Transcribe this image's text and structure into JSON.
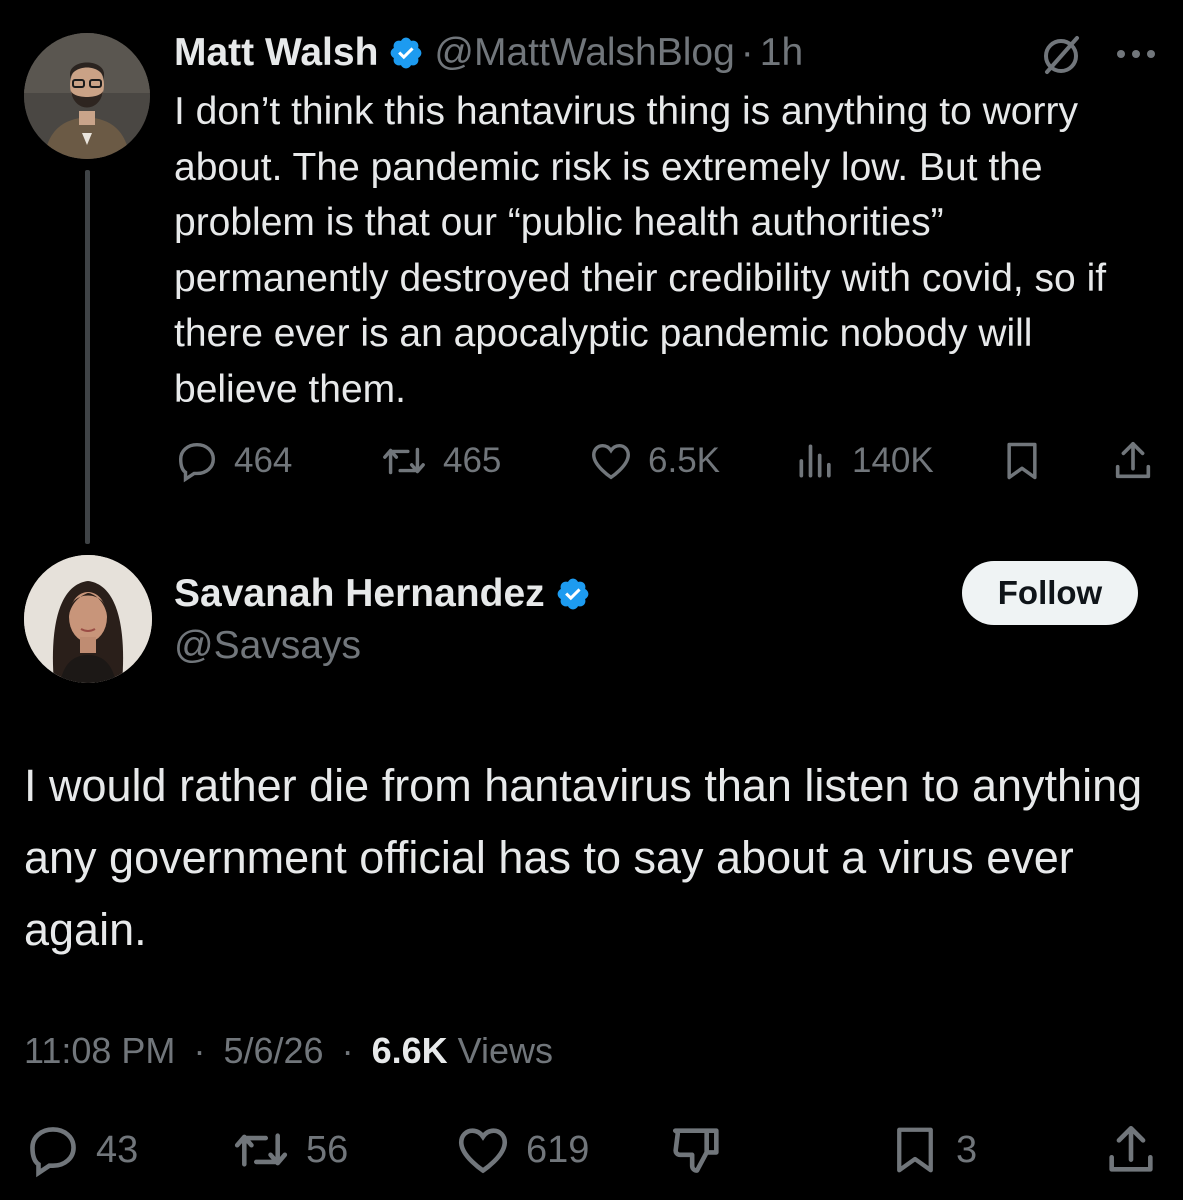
{
  "parent_tweet": {
    "display_name": "Matt Walsh",
    "handle": "@MattWalshBlog",
    "separator": "·",
    "time": "1h",
    "body": "I don’t think this hantavirus thing is anything to worry about. The pandemic risk is extremely low. But the problem is that our “public health authorities” permanently destroyed their credibility with covid, so if there ever is an apocalyptic pandemic nobody will believe them.",
    "replies": "464",
    "reposts": "465",
    "likes": "6.5K",
    "views": "140K",
    "icons": [
      "muted-circle-slash-icon",
      "more-icon",
      "reply-icon",
      "repost-icon",
      "like-icon",
      "views-icon",
      "bookmark-icon",
      "share-icon"
    ]
  },
  "reply_tweet": {
    "display_name": "Savanah Hernandez",
    "handle": "@Savsays",
    "follow_label": "Follow",
    "body": "I would rather die from hantavirus than listen to anything any government official has to say about a virus ever again.",
    "time": "11:08 PM",
    "date": "5/6/26",
    "separator": "·",
    "views_count": "6.6K",
    "views_label": "Views",
    "replies": "43",
    "reposts": "56",
    "likes": "619",
    "bookmarks": "3",
    "icons": [
      "reply-icon",
      "repost-icon",
      "like-icon",
      "downvote-icon",
      "bookmark-icon",
      "share-icon"
    ]
  },
  "colors": {
    "background": "#000000",
    "text": "#e7e9ea",
    "muted": "#71767b",
    "verified": "#1d9bf0",
    "follow_bg": "#eff3f4"
  }
}
